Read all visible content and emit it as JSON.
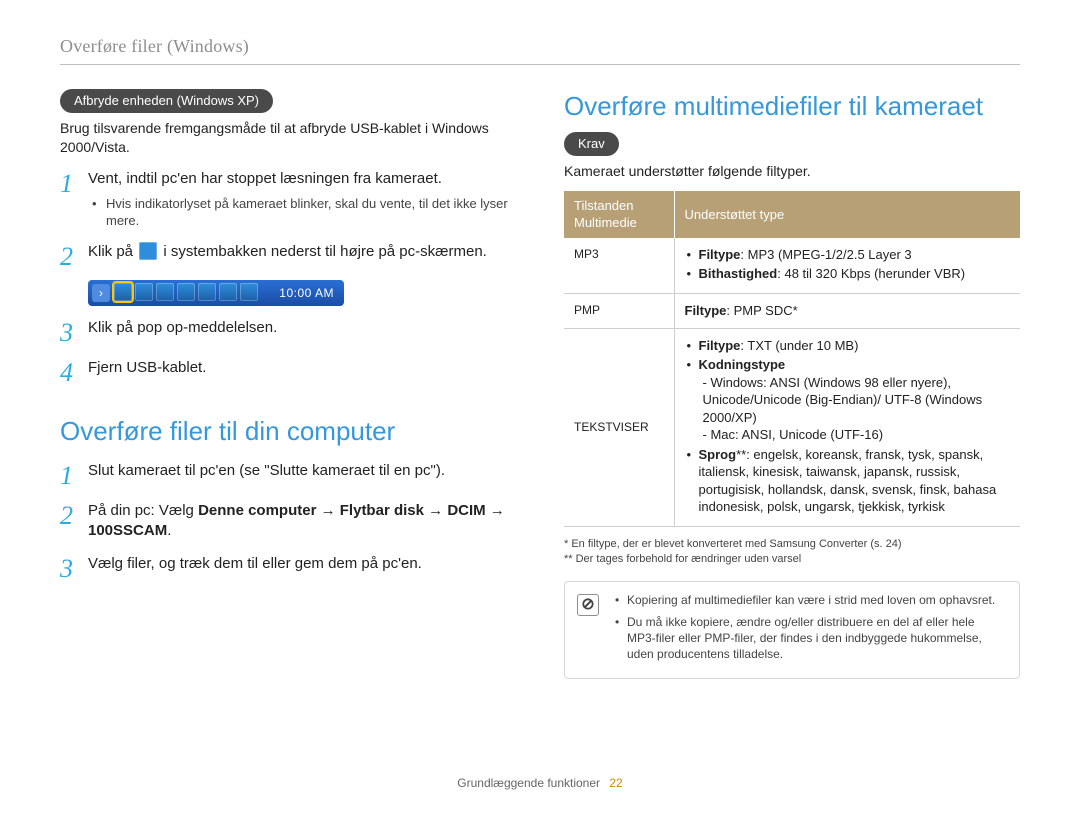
{
  "running_head": "Overføre filer (Windows)",
  "left": {
    "pill_disconnect": "Afbryde enheden (Windows XP)",
    "disconnect_lead": "Brug tilsvarende fremgangsmåde til at afbryde USB-kablet i Windows 2000/Vista.",
    "steps": [
      {
        "n": "1",
        "text": "Vent, indtil pc'en har stoppet læsningen fra kameraet.",
        "bullets": [
          "Hvis indikatorlyset på kameraet blinker, skal du vente, til det ikke lyser mere."
        ]
      },
      {
        "n": "2",
        "text_before": "Klik på ",
        "text_after": " i systembakken nederst til højre på pc-skærmen."
      },
      {
        "n": "3",
        "text": "Klik på pop op-meddelelsen."
      },
      {
        "n": "4",
        "text": "Fjern USB-kablet."
      }
    ],
    "tray_time": "10:00 AM",
    "h2_transfer": "Overføre filer til din computer",
    "transfer_steps": [
      {
        "n": "1",
        "text": "Slut kameraet til pc'en (se \"Slutte kameraet til en pc\")."
      },
      {
        "n": "2",
        "pre": "På din pc: Vælg ",
        "b1": "Denne computer",
        "arrow": " → ",
        "b2": "Flytbar disk",
        "arrow2": " → ",
        "b3": "DCIM",
        "arrow3": " → ",
        "b4": "100SSCAM",
        "post": "."
      },
      {
        "n": "3",
        "text": "Vælg filer, og træk dem til eller gem dem på pc'en."
      }
    ]
  },
  "right": {
    "h2_multi": "Overføre multimediefiler til kameraet",
    "pill_req": "Krav",
    "req_lead": "Kameraet understøtter følgende filtyper.",
    "table": {
      "th1_a": "Tilstanden",
      "th1_b": "Multimedie",
      "th2": "Understøttet type",
      "rows": [
        {
          "label": "MP3",
          "items": [
            {
              "bold": "Filtype",
              "rest": ": MP3 (MPEG-1/2/2.5 Layer 3"
            },
            {
              "bold": "Bithastighed",
              "rest": ": 48 til 320 Kbps (herunder VBR)"
            }
          ]
        },
        {
          "label": "PMP",
          "plain_bold": "Filtype",
          "plain_rest": ": PMP SDC*"
        },
        {
          "label": "TEKSTVISER",
          "mixed": {
            "l1_bold": "Filtype",
            "l1_rest": ": TXT (under 10 MB)",
            "l2_bold": "Kodningstype",
            "enc1": "- Windows: ANSI (Windows 98 eller nyere), Unicode/Unicode (Big-Endian)/ UTF-8 (Windows 2000/XP)",
            "enc2": "- Mac: ANSI, Unicode (UTF-16)",
            "l3_bold": "Sprog",
            "l3_marker": "**",
            "l3_rest": ": engelsk, koreansk, fransk, tysk, spansk, italiensk, kinesisk, taiwansk, japansk, russisk, portugisisk, hollandsk, dansk, svensk, finsk, bahasa indonesisk, polsk, ungarsk, tjekkisk, tyrkisk"
          }
        }
      ]
    },
    "footnote1": "* En filtype, der er blevet konverteret med Samsung Converter (s. 24)",
    "footnote2": "** Der tages forbehold for ændringer uden varsel",
    "note_box": {
      "b1": "Kopiering af multimediefiler kan være i strid med loven om ophavsret.",
      "b2": "Du må ikke kopiere, ændre og/eller distribuere en del af eller hele MP3-filer eller PMP-filer, der findes i den indbyggede hukommelse, uden producentens tilladelse."
    }
  },
  "footer": {
    "label": "Grundlæggende funktioner",
    "page": "22"
  }
}
